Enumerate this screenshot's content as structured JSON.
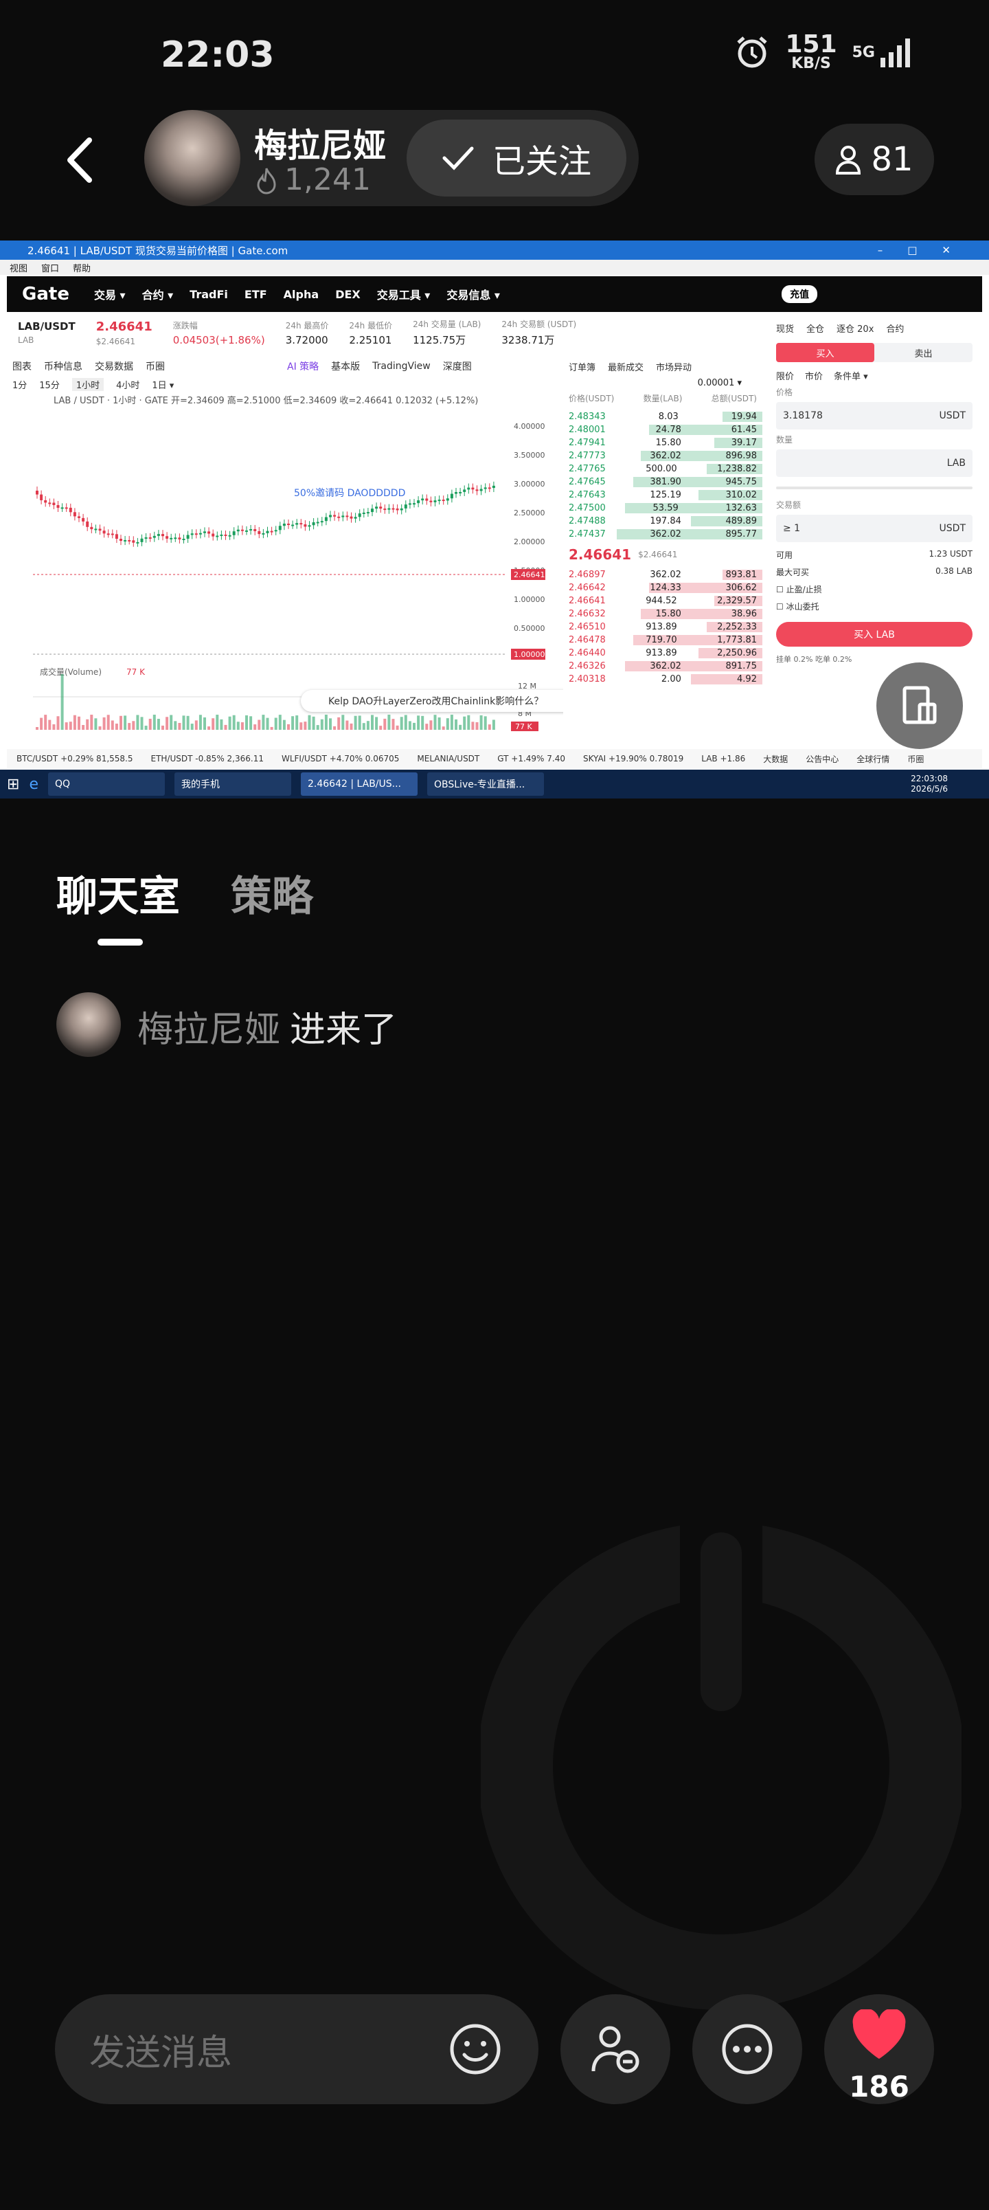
{
  "status_bar": {
    "time": "22:03",
    "speed_value": "151",
    "speed_unit": "KB/S",
    "network": "5G"
  },
  "header": {
    "streamer_name": "梅拉尼娅",
    "heat": "1,241",
    "follow_label": "已关注",
    "viewer_count": "81"
  },
  "screen": {
    "window_title": "2.46641 | LAB/USDT 现货交易当前价格图 | Gate.com",
    "menu": [
      "视图",
      "窗口",
      "帮助"
    ],
    "nav": {
      "logo": "Gate",
      "items": [
        "交易 ▾",
        "合约 ▾",
        "TradFi",
        "ETF",
        "Alpha",
        "DEX",
        "交易工具 ▾",
        "交易信息 ▾"
      ],
      "login": "充值"
    },
    "ticker": {
      "pair": "LAB/USDT",
      "sub": "LAB",
      "price": "2.46641",
      "price_sub": "$2.46641",
      "change_label": "涨跌幅",
      "change": "0.04503(+1.86%)",
      "high_label": "24h 最高价",
      "high": "3.72000",
      "low_label": "24h 最低价",
      "low": "2.25101",
      "vol_label": "24h 交易量 (LAB)",
      "vol": "1125.75万",
      "amount_label": "24h 交易额 (USDT)",
      "amount": "3238.71万"
    },
    "chart_tabs": [
      "图表",
      "币种信息",
      "交易数据",
      "币圈"
    ],
    "chart_views": [
      "AI 策略",
      "基本版",
      "TradingView",
      "深度图"
    ],
    "intervals": [
      "1分",
      "15分",
      "1小时",
      "4小时",
      "1日 ▾"
    ],
    "chart_info": "LAB / USDT · 1小时 · GATE  开=2.34609 高=2.51000 低=2.34609 收=2.46641 0.12032 (+5.12%)",
    "chart_note": "50%邀请码 DAODDDDD",
    "price_labels": [
      "4.00000",
      "3.50000",
      "3.00000",
      "2.50000",
      "2.00000",
      "1.50000",
      "1.00000",
      "0.50000"
    ],
    "current_price_tag": "2.46641",
    "ref_price_tag": "1.00000",
    "volume_label": "成交量(Volume)",
    "volume_value": "77 K",
    "vol_axis": [
      "12 M",
      "8 M"
    ],
    "vol_tag": "77 K",
    "ai_prompt": "Kelp DAO升LayerZero改用Chainlink影响什么？",
    "orderbook": {
      "tabs": [
        "订单簿",
        "最新成交",
        "市场异动"
      ],
      "precision": "0.00001 ▾",
      "headers": [
        "价格(USDT)",
        "数量(LAB)",
        "总额(USDT)"
      ],
      "bids_top": [
        [
          "2.48343",
          "8.03",
          "19.94"
        ],
        [
          "2.48001",
          "24.78",
          "61.45"
        ],
        [
          "2.47941",
          "15.80",
          "39.17"
        ],
        [
          "2.47773",
          "362.02",
          "896.98"
        ],
        [
          "2.47765",
          "500.00",
          "1,238.82"
        ],
        [
          "2.47645",
          "381.90",
          "945.75"
        ],
        [
          "2.47643",
          "125.19",
          "310.02"
        ],
        [
          "2.47500",
          "53.59",
          "132.63"
        ],
        [
          "2.47488",
          "197.84",
          "489.89"
        ],
        [
          "2.47437",
          "362.02",
          "895.77"
        ]
      ],
      "last_price": "2.46641",
      "last_price_sub": "$2.46641",
      "asks_bottom": [
        [
          "2.46897",
          "362.02",
          "893.81"
        ],
        [
          "2.46642",
          "124.33",
          "306.62"
        ],
        [
          "2.46641",
          "944.52",
          "2,329.57"
        ],
        [
          "2.46632",
          "15.80",
          "38.96"
        ],
        [
          "2.46510",
          "913.89",
          "2,252.33"
        ],
        [
          "2.46478",
          "719.70",
          "1,773.81"
        ],
        [
          "2.46440",
          "913.89",
          "2,250.96"
        ],
        [
          "2.46326",
          "362.02",
          "891.75"
        ],
        [
          "2.40318",
          "2.00",
          "4.92"
        ]
      ]
    },
    "trade": {
      "tabs": [
        "现货",
        "全仓",
        "逐仓 20x",
        "合约"
      ],
      "buy_label": "买入",
      "sell_label": "卖出",
      "order_types": [
        "限价",
        "市价",
        "条件单 ▾"
      ],
      "price_label": "价格",
      "price_value": "3.18178",
      "price_unit": "USDT",
      "qty_label": "数量",
      "qty_unit": "LAB",
      "amount_label": "交易额",
      "amount_value": "≥ 1",
      "amount_unit": "USDT",
      "avail_label": "可用",
      "avail_value": "1.23 USDT",
      "max_label": "最大可买",
      "max_value": "0.38 LAB",
      "check1": "止盈/止损",
      "check2": "冰山委托",
      "submit": "买入 LAB",
      "fee": "挂单 0.2%  吃单 0.2%"
    },
    "ticker_bar": [
      "BTC/USDT +0.29% 81,558.5",
      "ETH/USDT -0.85% 2,366.11",
      "WLFI/USDT +4.70% 0.06705",
      "MELANIA/USDT",
      "GT +1.49% 7.40",
      "SKYAI +19.90% 0.78019",
      "LAB +1.86",
      "大数据",
      "公告中心",
      "全球行情",
      "币圈"
    ],
    "taskbar": {
      "items": [
        "QQ",
        "我的手机",
        "2.46642 | LAB/US...",
        "OBSLive-专业直播..."
      ],
      "clock": "22:03:08",
      "date": "2026/5/6"
    }
  },
  "chat": {
    "tab_chat": "聊天室",
    "tab_strategy": "策略",
    "join_name": "梅拉尼娅",
    "join_text": "进来了"
  },
  "bottom": {
    "input_placeholder": "发送消息",
    "like_count": "186"
  },
  "colors": {
    "accent_red": "#e0384b",
    "like_red": "#ff3b57",
    "accent_green": "#1a9e5c"
  }
}
